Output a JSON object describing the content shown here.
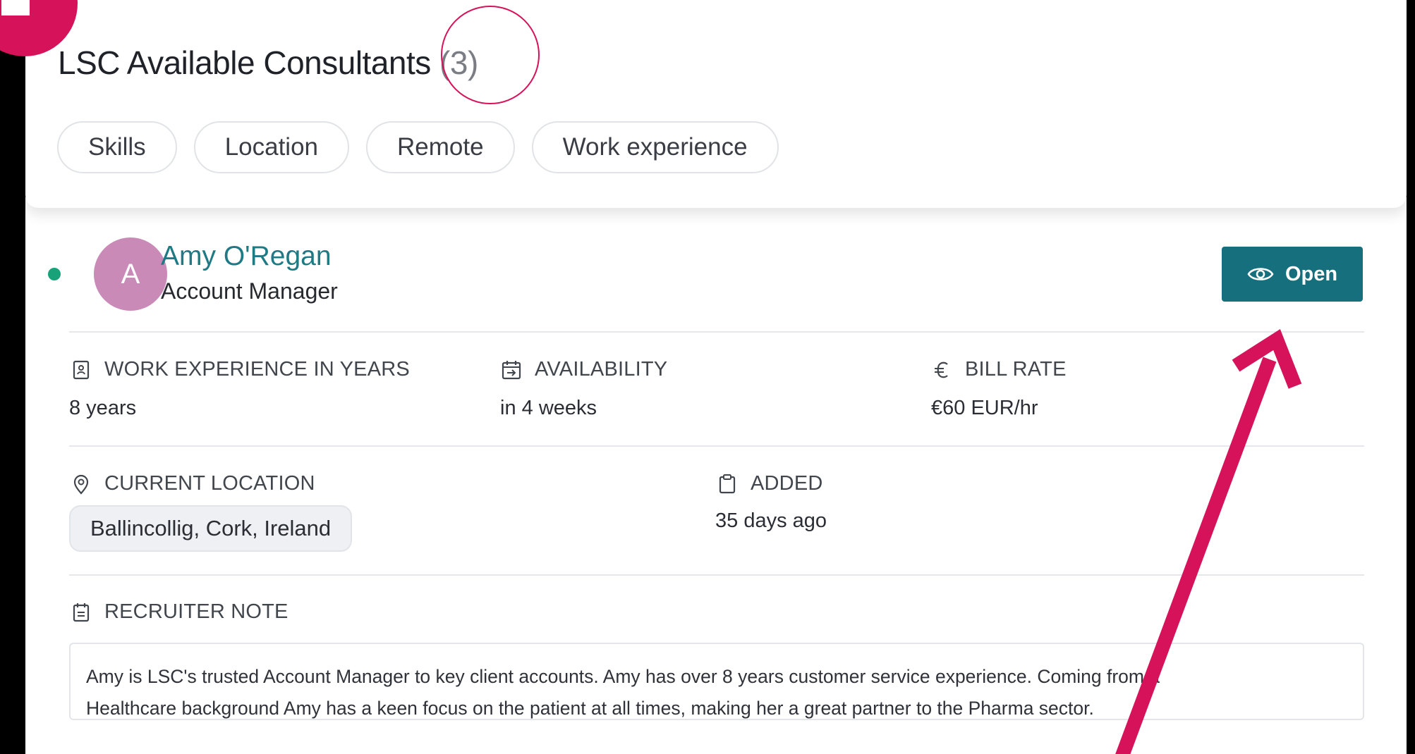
{
  "header": {
    "title": "LSC Available Consultants",
    "count": "(3)"
  },
  "filters": [
    "Skills",
    "Location",
    "Remote",
    "Work experience"
  ],
  "candidate": {
    "avatar_initial": "A",
    "name": "Amy O'Regan",
    "role": "Account Manager",
    "open_label": "Open",
    "work_experience": {
      "label": "WORK EXPERIENCE IN YEARS",
      "value": "8 years",
      "icon": "resume-icon"
    },
    "availability": {
      "label": "AVAILABILITY",
      "value": "in 4 weeks",
      "icon": "calendar-icon"
    },
    "bill_rate": {
      "label": "BILL RATE",
      "value": "€60 EUR/hr",
      "icon": "euro-icon"
    },
    "current_location": {
      "label": "CURRENT LOCATION",
      "value": "Ballincollig, Cork, Ireland",
      "icon": "map-pin-icon"
    },
    "added": {
      "label": "ADDED",
      "value": "35 days ago",
      "icon": "clipboard-icon"
    },
    "recruiter_note": {
      "label": "RECRUITER NOTE",
      "icon": "note-icon",
      "line1": "Amy is LSC's trusted Account Manager to key client accounts. Amy has over 8 years customer service experience. Coming from a",
      "line2": "Healthcare background Amy has a keen focus on the patient at all times, making her a great partner to the Pharma sector."
    }
  },
  "colors": {
    "accent": "#156f7c",
    "link": "#1e7a85",
    "annotation": "#d6135a",
    "status_online": "#1aa179",
    "avatar_bg": "#c98ab8"
  }
}
